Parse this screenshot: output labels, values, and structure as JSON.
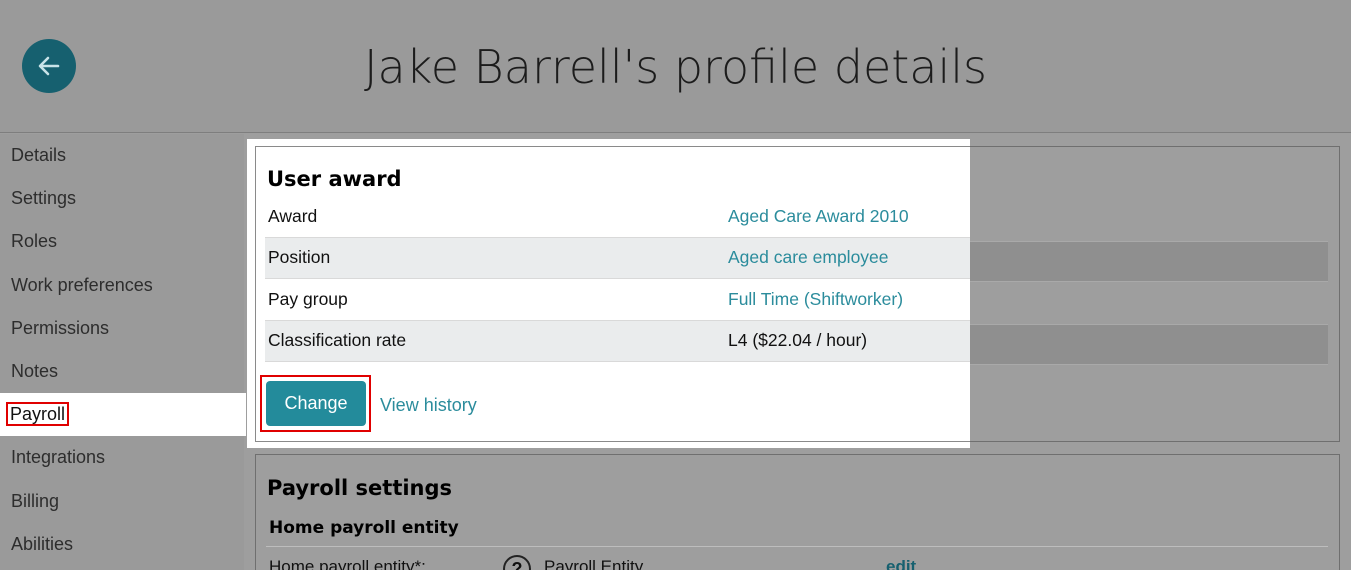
{
  "header": {
    "title": "Jake Barrell's profile details",
    "back_icon": "arrow-left-icon"
  },
  "sidebar": {
    "items": [
      {
        "label": "Details"
      },
      {
        "label": "Settings"
      },
      {
        "label": "Roles"
      },
      {
        "label": "Work preferences"
      },
      {
        "label": "Permissions"
      },
      {
        "label": "Notes"
      },
      {
        "label": "Payroll",
        "active": true
      },
      {
        "label": "Integrations"
      },
      {
        "label": "Billing"
      },
      {
        "label": "Abilities"
      }
    ]
  },
  "user_award": {
    "title": "User award",
    "rows": [
      {
        "key": "Award",
        "value": "Aged Care Award 2010"
      },
      {
        "key": "Position",
        "value": "Aged care employee"
      },
      {
        "key": "Pay group",
        "value": "Full Time (Shiftworker)"
      },
      {
        "key": "Classification rate",
        "value": "L4 ($22.04 / hour)"
      }
    ],
    "change_label": "Change",
    "view_history_label": "View history"
  },
  "payroll_settings": {
    "title": "Payroll settings",
    "home_entity_heading": "Home payroll entity",
    "home_entity_label": "Home payroll entity*:",
    "help_icon": "question-circle-icon",
    "entity_value": "Payroll Entity",
    "edit_label": "edit"
  },
  "colors": {
    "accent": "#238b9b",
    "link": "#2b8c9c",
    "highlight": "#e00000",
    "back_button": "#16606f"
  }
}
